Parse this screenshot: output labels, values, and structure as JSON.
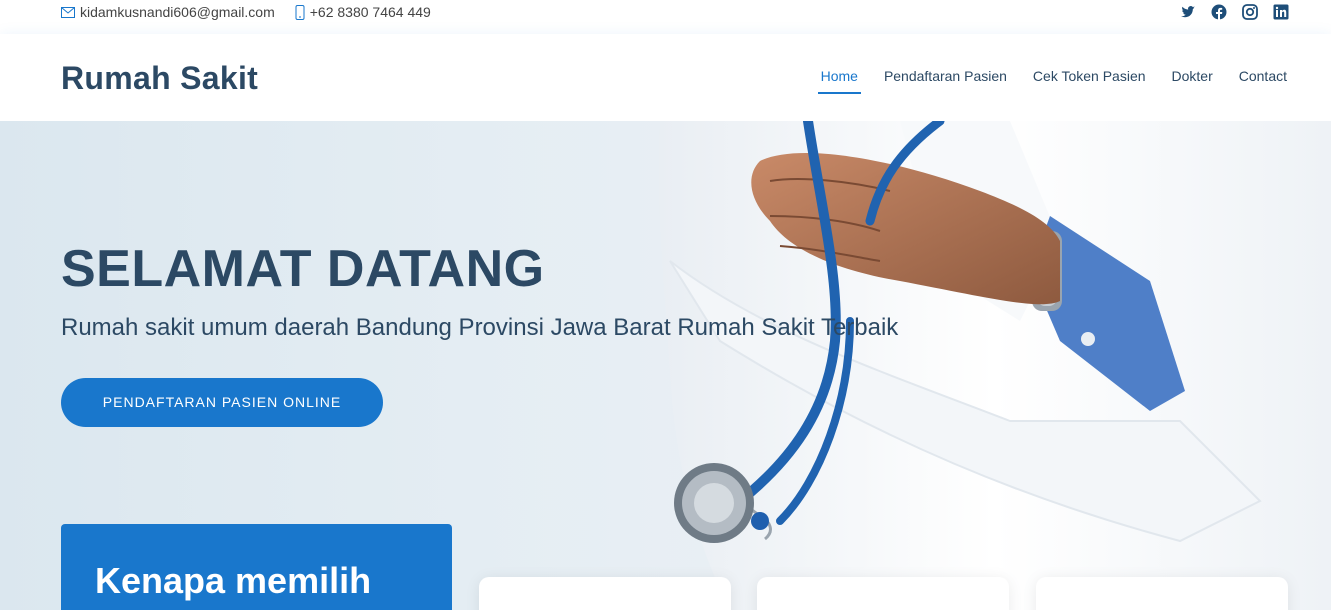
{
  "topbar": {
    "email": "kidamkusnandi606@gmail.com",
    "phone": "+62 8380 7464 449",
    "icons": {
      "email": "envelope-icon",
      "phone": "phone-icon",
      "social": [
        "twitter-icon",
        "facebook-icon",
        "instagram-icon",
        "linkedin-icon"
      ]
    }
  },
  "header": {
    "logo": "Rumah Sakit",
    "nav": [
      {
        "label": "Home",
        "active": true
      },
      {
        "label": "Pendaftaran Pasien"
      },
      {
        "label": "Cek Token Pasien"
      },
      {
        "label": "Dokter"
      },
      {
        "label": "Contact"
      }
    ]
  },
  "hero": {
    "title": "SELAMAT DATANG",
    "subtitle": "Rumah sakit umum daerah Bandung Provinsi Jawa Barat Rumah Sakit Terbaik",
    "cta_label": "PENDAFTARAN PASIEN ONLINE"
  },
  "why": {
    "title": "Kenapa memilih"
  },
  "colors": {
    "accent": "#1977cc",
    "text": "#2c4964"
  }
}
